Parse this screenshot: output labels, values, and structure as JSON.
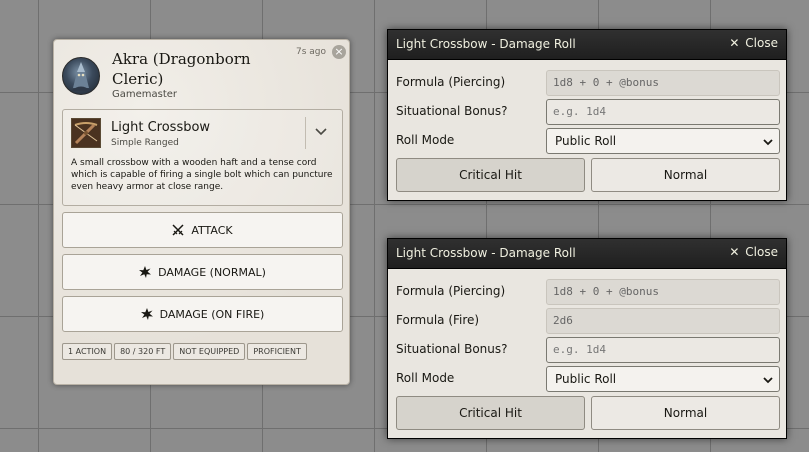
{
  "chat": {
    "speaker_name": "Akra (Dragonborn Cleric)",
    "speaker_role": "Gamemaster",
    "timestamp": "7s ago",
    "delete_glyph": "×",
    "item": {
      "name": "Light Crossbow",
      "subtitle": "Simple Ranged",
      "description": "A small crossbow with a wooden haft and a tense cord which is capable of firing a single bolt which can puncture even heavy armor at close range."
    },
    "buttons": {
      "attack": "ATTACK",
      "damage_normal": "DAMAGE (NORMAL)",
      "damage_fire": "DAMAGE (ON FIRE)"
    },
    "tags": [
      "1 ACTION",
      "80 / 320 FT",
      "NOT EQUIPPED",
      "PROFICIENT"
    ],
    "icons": {
      "attack": "crossed-swords-icon",
      "damage": "burst-icon",
      "chevron": "chevron-down-icon",
      "delete": "close-circle-icon"
    }
  },
  "dialog1": {
    "title": "Light Crossbow - Damage Roll",
    "close_label": "Close",
    "close_glyph": "✕",
    "formula_piercing_label": "Formula (Piercing)",
    "formula_piercing_value": "1d8 + 0 + @bonus",
    "situational_label": "Situational Bonus?",
    "situational_placeholder": "e.g. 1d4",
    "roll_mode_label": "Roll Mode",
    "roll_mode_value": "Public Roll",
    "critical_label": "Critical Hit",
    "normal_label": "Normal"
  },
  "dialog2": {
    "title": "Light Crossbow - Damage Roll",
    "close_label": "Close",
    "close_glyph": "✕",
    "formula_piercing_label": "Formula (Piercing)",
    "formula_piercing_value": "1d8 + 0 + @bonus",
    "formula_fire_label": "Formula (Fire)",
    "formula_fire_value": "2d6",
    "situational_label": "Situational Bonus?",
    "situational_placeholder": "e.g. 1d4",
    "roll_mode_label": "Roll Mode",
    "roll_mode_value": "Public Roll",
    "critical_label": "Critical Hit",
    "normal_label": "Normal"
  },
  "colors": {
    "canvas": "#8c8c8c",
    "card_bg": "#ebe7e0",
    "dialog_header": "#262626",
    "dialog_bg": "#e9e6e0"
  }
}
